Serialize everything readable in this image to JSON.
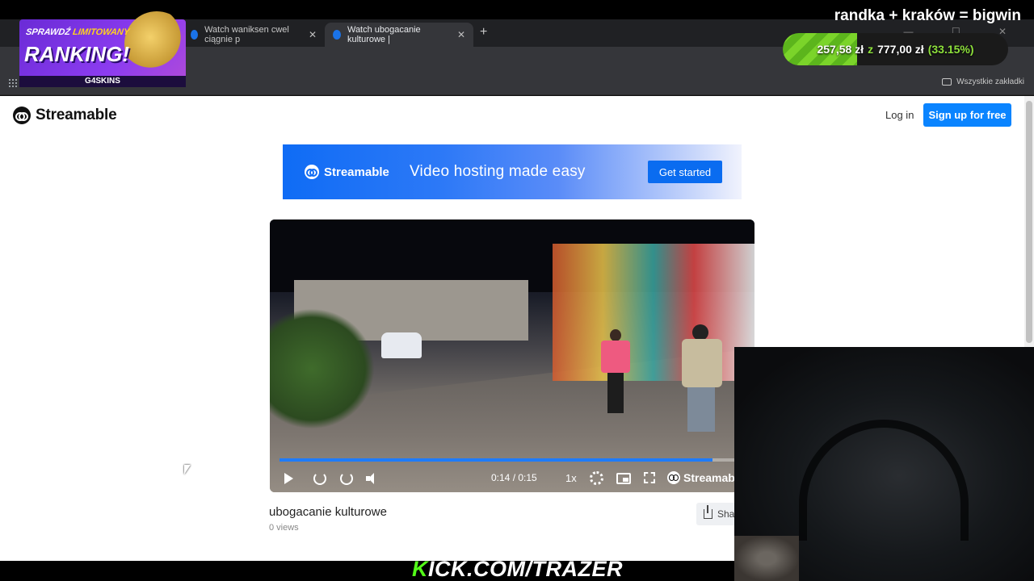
{
  "browser": {
    "tabs": [
      {
        "label": "Watch waniksen cwel ciągnie p",
        "active": false
      },
      {
        "label": "Watch ubogacanie kulturowe |",
        "active": true
      }
    ],
    "new_tab_label": "+",
    "window_controls": "— ☐ ✕",
    "bookmarks_label": "Wszystkie zakładki"
  },
  "site": {
    "logo_text": "Streamable",
    "login_label": "Log in",
    "signup_label": "Sign up for free"
  },
  "banner": {
    "logo_text": "Streamable",
    "tagline": "Video hosting made easy",
    "cta_label": "Get started"
  },
  "player": {
    "time": "0:14 / 0:15",
    "progress_fraction": 0.93,
    "speed": "1x",
    "brand": "Streamable"
  },
  "video": {
    "title": "ubogacanie kulturowe",
    "views": "0 views",
    "share_label": "Sha"
  },
  "overlay": {
    "stream_title": "randka + kraków = bigwin",
    "goal": {
      "current": "257,58 zł",
      "separator": "z",
      "target": "777,00 zł",
      "percent_text": "(33.15%)",
      "fraction": 0.3315
    },
    "promo": {
      "line1_prefix": "SPRAWDŹ ",
      "line1_highlight": "LIMITOWANY",
      "line2": "RANKING!",
      "brand": "G4SKINS"
    },
    "kick_prefix": "K",
    "kick_rest": "ICK.COM/TRAZER"
  },
  "colors": {
    "accent": "#0a84ff",
    "kick_green": "#53fc18",
    "goal_green": "#7bd42a"
  }
}
